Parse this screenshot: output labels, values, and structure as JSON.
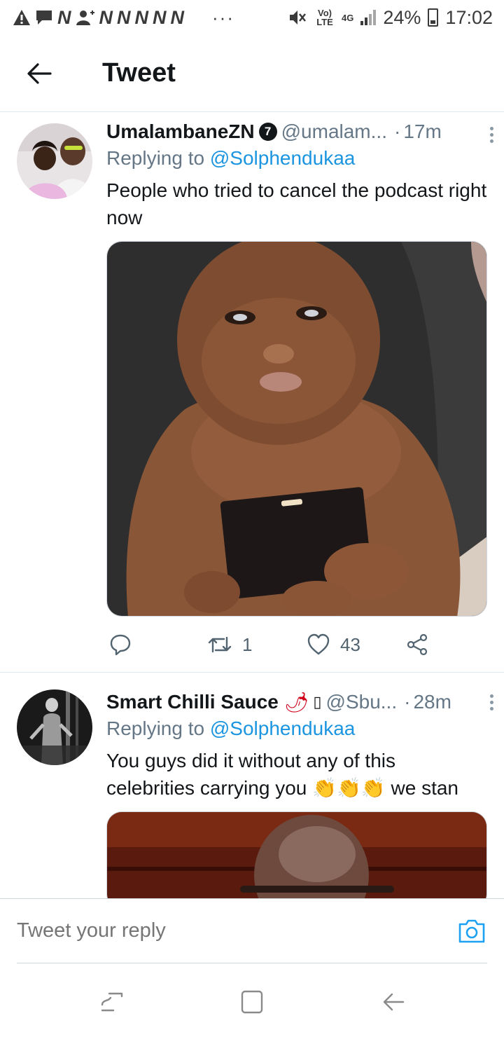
{
  "status_bar": {
    "network_letters": [
      "N",
      "N",
      "N",
      "N",
      "N",
      "N"
    ],
    "overflow": "···",
    "volte": "Vo) LTE",
    "network_type": "4G",
    "battery_percent": "24%",
    "battery_level": 0.24,
    "time": "17:02"
  },
  "header": {
    "title": "Tweet"
  },
  "tweets": [
    {
      "name": "UmalambaneZN",
      "badge": "7",
      "handle": "@umalam...",
      "separator": "·",
      "time": "17m",
      "replying_prefix": "Replying to",
      "replying_to": "@Solphendukaa",
      "text": "People who tried to cancel the podcast right now",
      "retweets": "1",
      "likes": "43"
    },
    {
      "name": "Smart Chilli Sauce",
      "name_emoji": "🌶",
      "name_extra": "▯",
      "handle": "@Sbu...",
      "separator": "·",
      "time": "28m",
      "replying_prefix": "Replying to",
      "replying_to": "@Solphendukaa",
      "text_start": "You guys did it without any of this celebrities carrying you",
      "text_emoji": "👏👏👏",
      "text_end": "we stan"
    }
  ],
  "composer": {
    "placeholder": "Tweet your reply"
  },
  "colors": {
    "link": "#1b95e0",
    "secondary": "#657786",
    "divider": "#e1e8ed"
  },
  "icons": {
    "back": "arrow-left-icon",
    "verified": "verified-badge",
    "more": "more-vertical-icon",
    "reply": "reply-icon",
    "retweet": "retweet-icon",
    "like": "heart-icon",
    "share": "share-icon",
    "camera": "camera-icon",
    "recents": "recents-icon",
    "home": "home-icon",
    "nav_back": "nav-back-icon"
  }
}
